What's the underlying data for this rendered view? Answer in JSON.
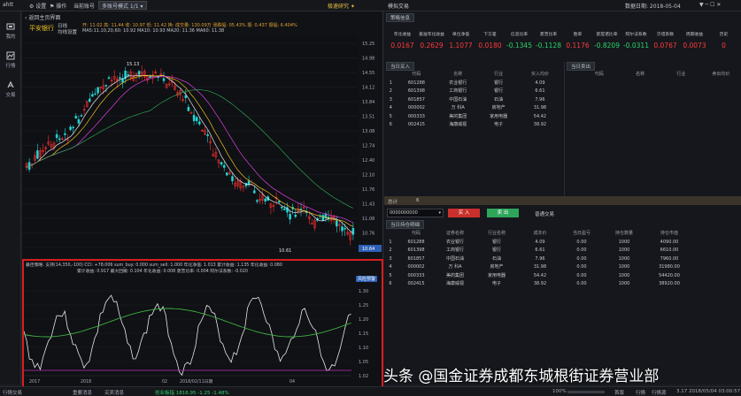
{
  "menubar": {
    "logo": "ahtt",
    "settings": "设置",
    "operation": "操作",
    "current_index": "当前账号",
    "mode_select": "多账号模式 1/1",
    "right_title": "模拟交易",
    "date_label": "数据日期: 2018-05-04"
  },
  "sidenav": [
    {
      "label": "我的"
    },
    {
      "label": "行情"
    },
    {
      "label": "交易"
    }
  ],
  "kline": {
    "back_link": "返回主页界面",
    "stock_name": "平安银行",
    "period": "日线",
    "ma_title": "均线设置",
    "info_line1": "开: 11.02  高: 11.44  收: 10.97  低: 11.42  换: 成交量: 130.09万  涨跌幅: 05.43%  振: 0.437  振幅: 6.404%",
    "ma_line": "MA5:11.10,20,60: 10.92  MA10: 10.93  MA20: 11.36  MA60: 11.38",
    "high_marker": "15.13",
    "low_marker": "10.61",
    "price_ticks": [
      "15.25",
      "14.98",
      "14.55",
      "14.12",
      "13.84",
      "13.51",
      "13.08",
      "12.74",
      "12.40",
      "12.10",
      "11.76",
      "11.43",
      "11.08",
      "10.76",
      "10.39"
    ],
    "highlight_price": "10.64"
  },
  "indicator": {
    "title": "最佳策略: 支持(14,350,-100) CCI: +78.006  sum_buy: 0.000  sum_sell: 1.000  年化净值: 1.013  累计收益: 1.135  年化收益: 0.080",
    "line2": "累计收益: 0.917  最大回撤: 0.104  年化收益: 0.008  夏普比率: 0.004  阿尔法系数: -0.020",
    "badge": "风险预警",
    "ticks": [
      "1.30",
      "1.25",
      "1.20",
      "1.15",
      "1.10",
      "1.05",
      "1.02"
    ],
    "xlabels": [
      "2017",
      "2018",
      "02",
      "2018/02/11日期",
      "04"
    ]
  },
  "right": {
    "tab_strategy": "策略信息",
    "metrics": [
      {
        "label": "年化收益",
        "value": "0.0167",
        "color": "#ff3b3b"
      },
      {
        "label": "基准年化收益",
        "value": "0.2629",
        "color": "#ff3b3b"
      },
      {
        "label": "单位净值",
        "value": "1.1077",
        "color": "#ff3b3b"
      },
      {
        "label": "下方差",
        "value": "0.0180",
        "color": "#ff3b3b"
      },
      {
        "label": "信息比率",
        "value": "-0.1345",
        "color": "#2bd46b"
      },
      {
        "label": "夏普比率",
        "value": "-0.1128",
        "color": "#2bd46b"
      },
      {
        "label": "胜率",
        "value": "0.1176",
        "color": "#ff3b3b"
      },
      {
        "label": "索提诺比率",
        "value": "-0.8209",
        "color": "#2bd46b"
      },
      {
        "label": "阿尔法系数",
        "value": "-0.0311",
        "color": "#2bd46b"
      },
      {
        "label": "贝塔系数",
        "value": "0.0767",
        "color": "#ff3b3b"
      },
      {
        "label": "周期收益",
        "value": "0.0073",
        "color": "#ff3b3b"
      },
      {
        "label": "历史",
        "value": "0",
        "color": "#ff3b3b"
      }
    ],
    "buy_tab": "当日买入",
    "sell_tab": "当日卖出",
    "buy_headers": [
      "代码",
      "名称",
      "行业",
      "买入均价"
    ],
    "buy_rows": [
      {
        "idx": "1",
        "code": "601288",
        "name": "农业银行",
        "industry": "银行",
        "price": "4.09"
      },
      {
        "idx": "2",
        "code": "601398",
        "name": "工商银行",
        "industry": "银行",
        "price": "6.61"
      },
      {
        "idx": "3",
        "code": "601857",
        "name": "中国石油",
        "industry": "石油",
        "price": "7.96"
      },
      {
        "idx": "4",
        "code": "000002",
        "name": "万 科A",
        "industry": "房地产",
        "price": "31.98"
      },
      {
        "idx": "5",
        "code": "000333",
        "name": "美的集团",
        "industry": "家用电器",
        "price": "54.42"
      },
      {
        "idx": "6",
        "code": "002415",
        "name": "海康威视",
        "industry": "电子",
        "price": "38.92"
      }
    ],
    "sell_headers": [
      "代码",
      "名称",
      "行业",
      "卖出均价"
    ],
    "total_label": "总计",
    "total_value": "6",
    "account_input": "0000000000",
    "buy_btn": "买 入",
    "sell_btn": "卖 出",
    "normal_trade": "普通交易",
    "position_tab": "当日持仓明细",
    "pos_headers": [
      "代码",
      "证券名称",
      "行业名称",
      "成本价",
      "当日盈亏",
      "持仓数量",
      "持仓市值"
    ],
    "pos_rows": [
      {
        "idx": "1",
        "code": "601288",
        "name": "农业银行",
        "industry": "银行",
        "cost": "4.09",
        "pnl": "0.00",
        "qty": "1000",
        "value": "4090.00"
      },
      {
        "idx": "2",
        "code": "601398",
        "name": "工商银行",
        "industry": "银行",
        "cost": "6.61",
        "pnl": "0.00",
        "qty": "1000",
        "value": "6610.00"
      },
      {
        "idx": "3",
        "code": "601857",
        "name": "中国石油",
        "industry": "石油",
        "cost": "7.96",
        "pnl": "0.00",
        "qty": "1000",
        "value": "7960.00"
      },
      {
        "idx": "4",
        "code": "000002",
        "name": "万 科A",
        "industry": "房地产",
        "cost": "31.98",
        "pnl": "0.00",
        "qty": "1000",
        "value": "31980.00"
      },
      {
        "idx": "5",
        "code": "000333",
        "name": "美的集团",
        "industry": "家用电器",
        "cost": "54.42",
        "pnl": "0.00",
        "qty": "1000",
        "value": "54420.00"
      },
      {
        "idx": "6",
        "code": "002415",
        "name": "海康威视",
        "industry": "电子",
        "cost": "38.92",
        "pnl": "0.00",
        "qty": "1000",
        "value": "38920.00"
      }
    ]
  },
  "status": {
    "left1": "行情交易",
    "left2": "重要消息",
    "left3": "买卖消息",
    "left4": "创业板指  1816.95  -1.25  -1.48%",
    "zoom": "100%",
    "s1": "首版",
    "s2": "行情",
    "s3": "行情源",
    "s4": "3.17",
    "time": "2018/05/04 03:00:57"
  },
  "watermark": "头条 @国金证券成都东城根街证券营业部"
}
